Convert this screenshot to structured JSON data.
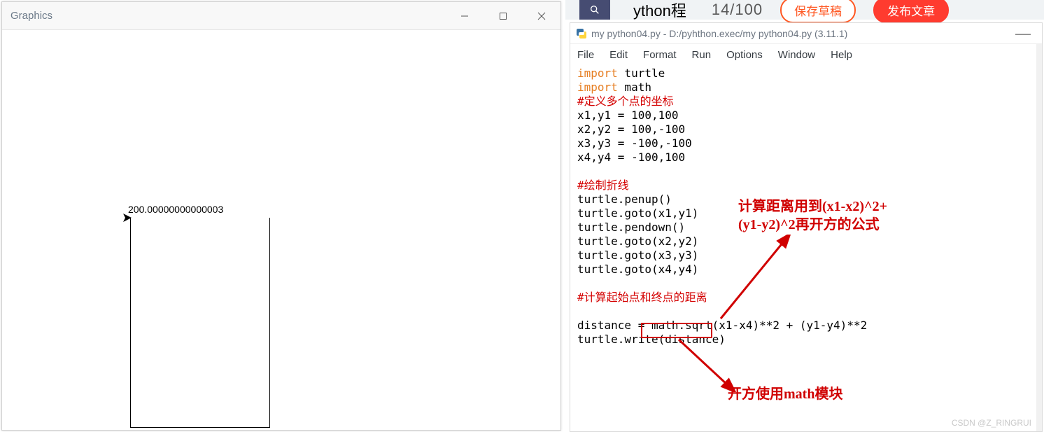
{
  "graphics_window": {
    "title": "Graphics",
    "output_value": "200.00000000000003"
  },
  "top_strip": {
    "partial_label": "ython程",
    "counter": "14/100",
    "button_save": "保存草稿",
    "button_publish": "发布文章"
  },
  "idle_window": {
    "title": "my python04.py - D:/pyhthon.exec/my python04.py (3.11.1)",
    "menu": {
      "file": "File",
      "edit": "Edit",
      "format": "Format",
      "run": "Run",
      "options": "Options",
      "window": "Window",
      "help": "Help"
    },
    "code": {
      "l1a": "import",
      "l1b": " turtle",
      "l2a": "import",
      "l2b": " math",
      "l3": "#定义多个点的坐标",
      "l4": "x1,y1 = 100,100",
      "l5": "x2,y2 = 100,-100",
      "l6": "x3,y3 = -100,-100",
      "l7": "x4,y4 = -100,100",
      "l8": "",
      "l9": "#绘制折线",
      "l10": "turtle.penup()",
      "l11": "turtle.goto(x1,y1)",
      "l12": "turtle.pendown()",
      "l13": "turtle.goto(x2,y2)",
      "l14": "turtle.goto(x3,y3)",
      "l15": "turtle.goto(x4,y4)",
      "l16": "",
      "l17": "#计算起始点和终点的距离",
      "l18": "",
      "l19": "distance = math.sqrt(x1-x4)**2 + (y1-y4)**2",
      "l20": "turtle.write(distance)"
    }
  },
  "annotations": {
    "a1_line1": "计算距离用到(x1-x2)^2+",
    "a1_line2": "(y1-y2)^2再开方的公式",
    "a2": "开方使用math模块"
  },
  "watermark": "CSDN @Z_RINGRUI"
}
